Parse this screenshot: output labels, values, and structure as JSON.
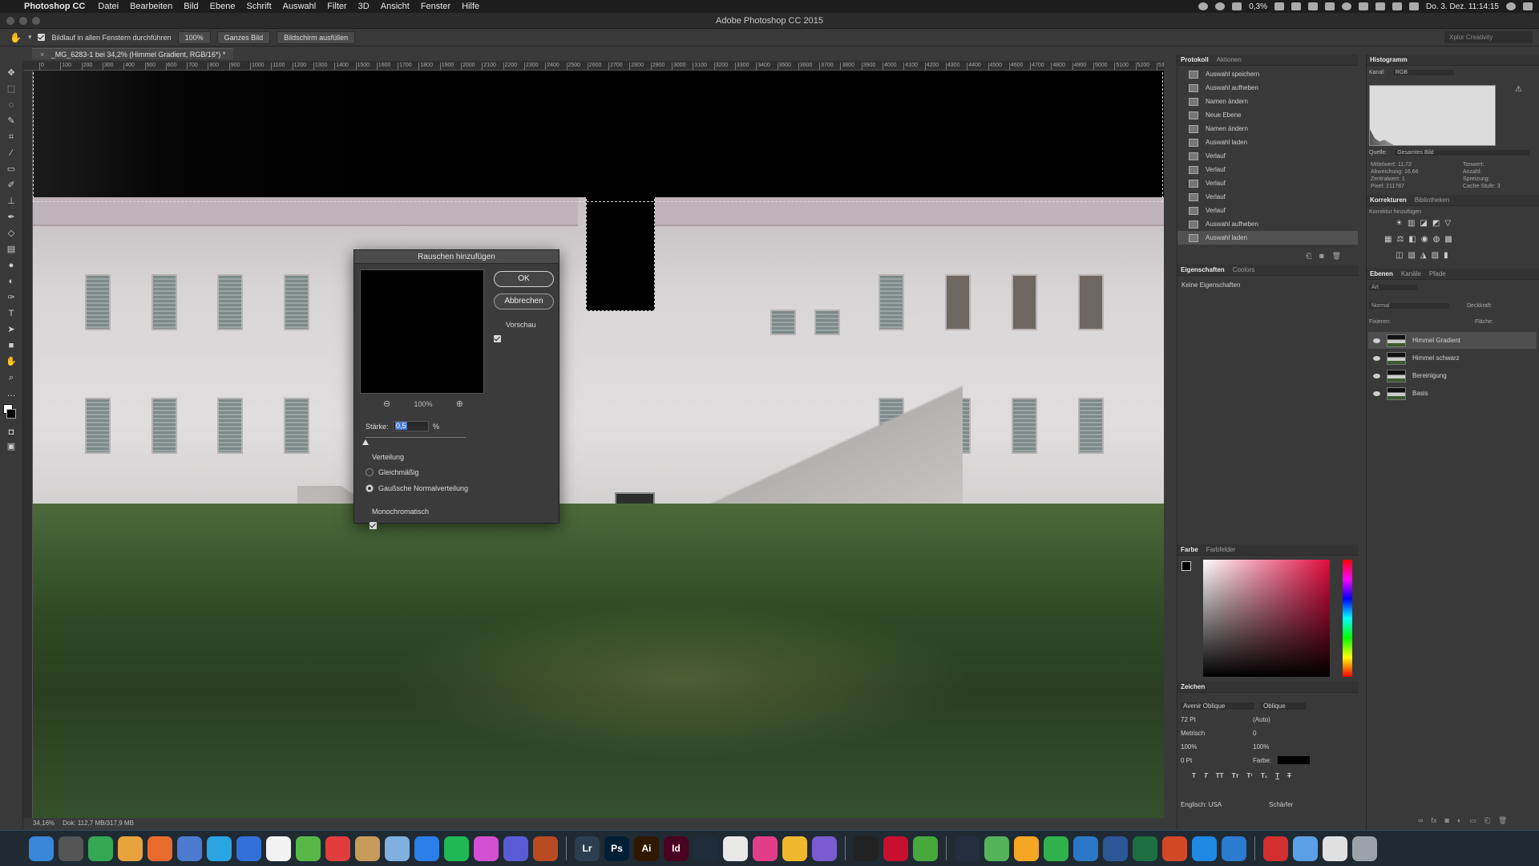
{
  "menubar": {
    "app_name": "Photoshop CC",
    "items": [
      "Datei",
      "Bearbeiten",
      "Bild",
      "Ebene",
      "Schrift",
      "Auswahl",
      "Filter",
      "3D",
      "Ansicht",
      "Fenster",
      "Hilfe"
    ],
    "battery": "0,3%",
    "clock": "Do. 3. Dez.  11:14:15"
  },
  "window": {
    "title": "Adobe Photoshop CC 2015"
  },
  "options": {
    "scroll_all": "Bildlauf in allen Fenstern durchführen",
    "zoom100": "100%",
    "fit": "Ganzes Bild",
    "fill": "Bildschirm ausfüllen",
    "search_placeholder": "Xplor Creativity"
  },
  "document": {
    "tab": "_MG_6283-1 bei 34,2% (Himmel Gradient, RGB/16*) *",
    "status_zoom": "34,16%",
    "status_doc": "Dok: 112,7 MB/317,9 MB"
  },
  "ruler": {
    "ticks": [
      "0",
      "100",
      "200",
      "300",
      "400",
      "500",
      "600",
      "700",
      "800",
      "900",
      "1000",
      "1100",
      "1200",
      "1300",
      "1400",
      "1500",
      "1600",
      "1700",
      "1800",
      "1900",
      "2000",
      "2100",
      "2200",
      "2300",
      "2400",
      "2500",
      "2600",
      "2700",
      "2800",
      "2900",
      "3000",
      "3100",
      "3200",
      "3300",
      "3400",
      "3500",
      "3600",
      "3700",
      "3800",
      "3900",
      "4000",
      "4100",
      "4200",
      "4300",
      "4400",
      "4500",
      "4600",
      "4700",
      "4800",
      "4900",
      "5000",
      "5100",
      "5200",
      "5300",
      "540"
    ]
  },
  "dialog": {
    "title": "Rauschen hinzufügen",
    "ok": "OK",
    "cancel": "Abbrechen",
    "preview_label": "Vorschau",
    "zoom": "100%",
    "amount_label": "Stärke:",
    "amount_value": "0,5",
    "amount_unit": "%",
    "distribution_label": "Verteilung",
    "uniform": "Gleichmäßig",
    "gaussian": "Gaußsche Normalverteilung",
    "mono": "Monochromatisch"
  },
  "history": {
    "tabs": [
      "Protokoll",
      "Aktionen"
    ],
    "items": [
      "Auswahl speichern",
      "Auswahl aufheben",
      "Namen ändern",
      "Neue Ebene",
      "Namen ändern",
      "Auswahl laden",
      "Verlauf",
      "Verlauf",
      "Verlauf",
      "Verlauf",
      "Verlauf",
      "Auswahl aufheben",
      "Auswahl laden"
    ]
  },
  "properties": {
    "tabs": [
      "Eigenschaften",
      "Coolors"
    ],
    "empty": "Keine Eigenschaften"
  },
  "color_panel": {
    "tabs": [
      "Farbe",
      "Farbfelder"
    ]
  },
  "character": {
    "title": "Zeichen",
    "font": "Avenir Oblique",
    "style": "Oblique",
    "size": "72 Pt",
    "leading": "(Auto)",
    "kerning": "Metrisch",
    "tracking": "0",
    "vscale": "100%",
    "hscale": "100%",
    "baseline": "0 Pt",
    "color_label": "Farbe:",
    "language": "Englisch: USA",
    "aa": "Schärfer"
  },
  "histogram": {
    "title": "Histogramm",
    "channel_label": "Kanal:",
    "channel": "RGB",
    "source_label": "Quelle:",
    "source": "Gesamtes Bild",
    "stats_left": [
      "Mittelwert: 11,72",
      "Abweichung: 16,66",
      "Zentralwert: 1",
      "Pixel: 211787"
    ],
    "stats_right": [
      "Tonwert:",
      "Anzahl:",
      "Spreizung:",
      "Cache-Stufe: 3"
    ]
  },
  "adjustments": {
    "tabs": [
      "Korrekturen",
      "Bibliotheken"
    ],
    "hint": "Korrektur hinzufügen"
  },
  "layers": {
    "tabs": [
      "Ebenen",
      "Kanäle",
      "Pfade"
    ],
    "kind": "Art",
    "blend": "Normal",
    "opacity_label": "Deckkraft:",
    "fix_label": "Fixieren:",
    "fill_label": "Fläche:",
    "items": [
      "Himmel Gradient",
      "Himmel schwarz",
      "Bereinigung",
      "Basis"
    ]
  },
  "dock_apps": [
    "Finder",
    "Launchpad",
    "Chrome",
    "Firefox",
    "Thunderbird",
    "Mail",
    "1Password",
    "Scrivener",
    "Evernote",
    "Wunderlist",
    "Notebooks",
    "Preview",
    "Safari",
    "App Store",
    "Spotify",
    "iTunes",
    "iMovie",
    "Cocktail",
    "Lr",
    "Ps",
    "Ai",
    "Id",
    "Capture",
    "Photos",
    "Colors",
    "Sketch",
    "Speed",
    "Terminal",
    "FileZilla",
    "Leaf",
    "Amazon",
    "Maps",
    "Pages",
    "Numbers",
    "Keynote",
    "Word",
    "Excel",
    "PowerPoint",
    "Safari2",
    "1Password2",
    "Acrobat",
    "Folder",
    "Docs",
    "Trash"
  ]
}
